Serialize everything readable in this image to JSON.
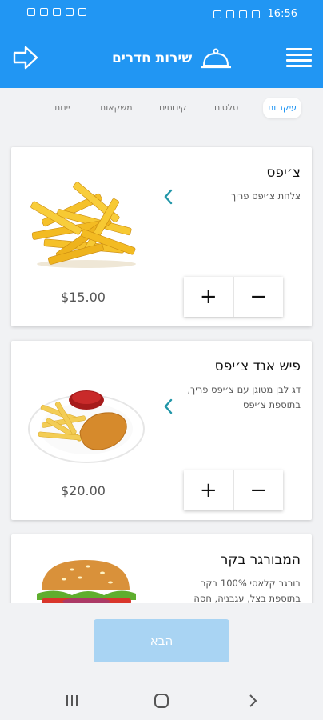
{
  "status_bar": {
    "time": "16:56"
  },
  "header": {
    "title": "שירות חדרים"
  },
  "tabs": [
    {
      "label": "עיקריות",
      "active": true
    },
    {
      "label": "סלטים",
      "active": false
    },
    {
      "label": "קינוחים",
      "active": false
    },
    {
      "label": "משקאות",
      "active": false
    },
    {
      "label": "יינות",
      "active": false
    }
  ],
  "items": [
    {
      "name": "צ׳יפס",
      "description": "צלחת צ׳יפס פריך",
      "price": "$15.00",
      "image": "fries"
    },
    {
      "name": "פיש אנד צ׳יפס",
      "description": "דג לבן מטוגן עם צ׳יפס פריך, בתוספת צ׳יפס",
      "price": "$20.00",
      "image": "fish-and-chips"
    },
    {
      "name": "המבורגר בקר",
      "description": "בורגר קלאסי 100% בקר בתוספת בצל, עגבניה, חסה",
      "price": "",
      "image": "burger"
    }
  ],
  "stepper": {
    "plus": "+",
    "minus": "−"
  },
  "next_button": {
    "label": "הבא"
  },
  "colors": {
    "primary": "#2196f3",
    "next_button_disabled": "#a9d4f3",
    "background": "#f1f2f4"
  }
}
